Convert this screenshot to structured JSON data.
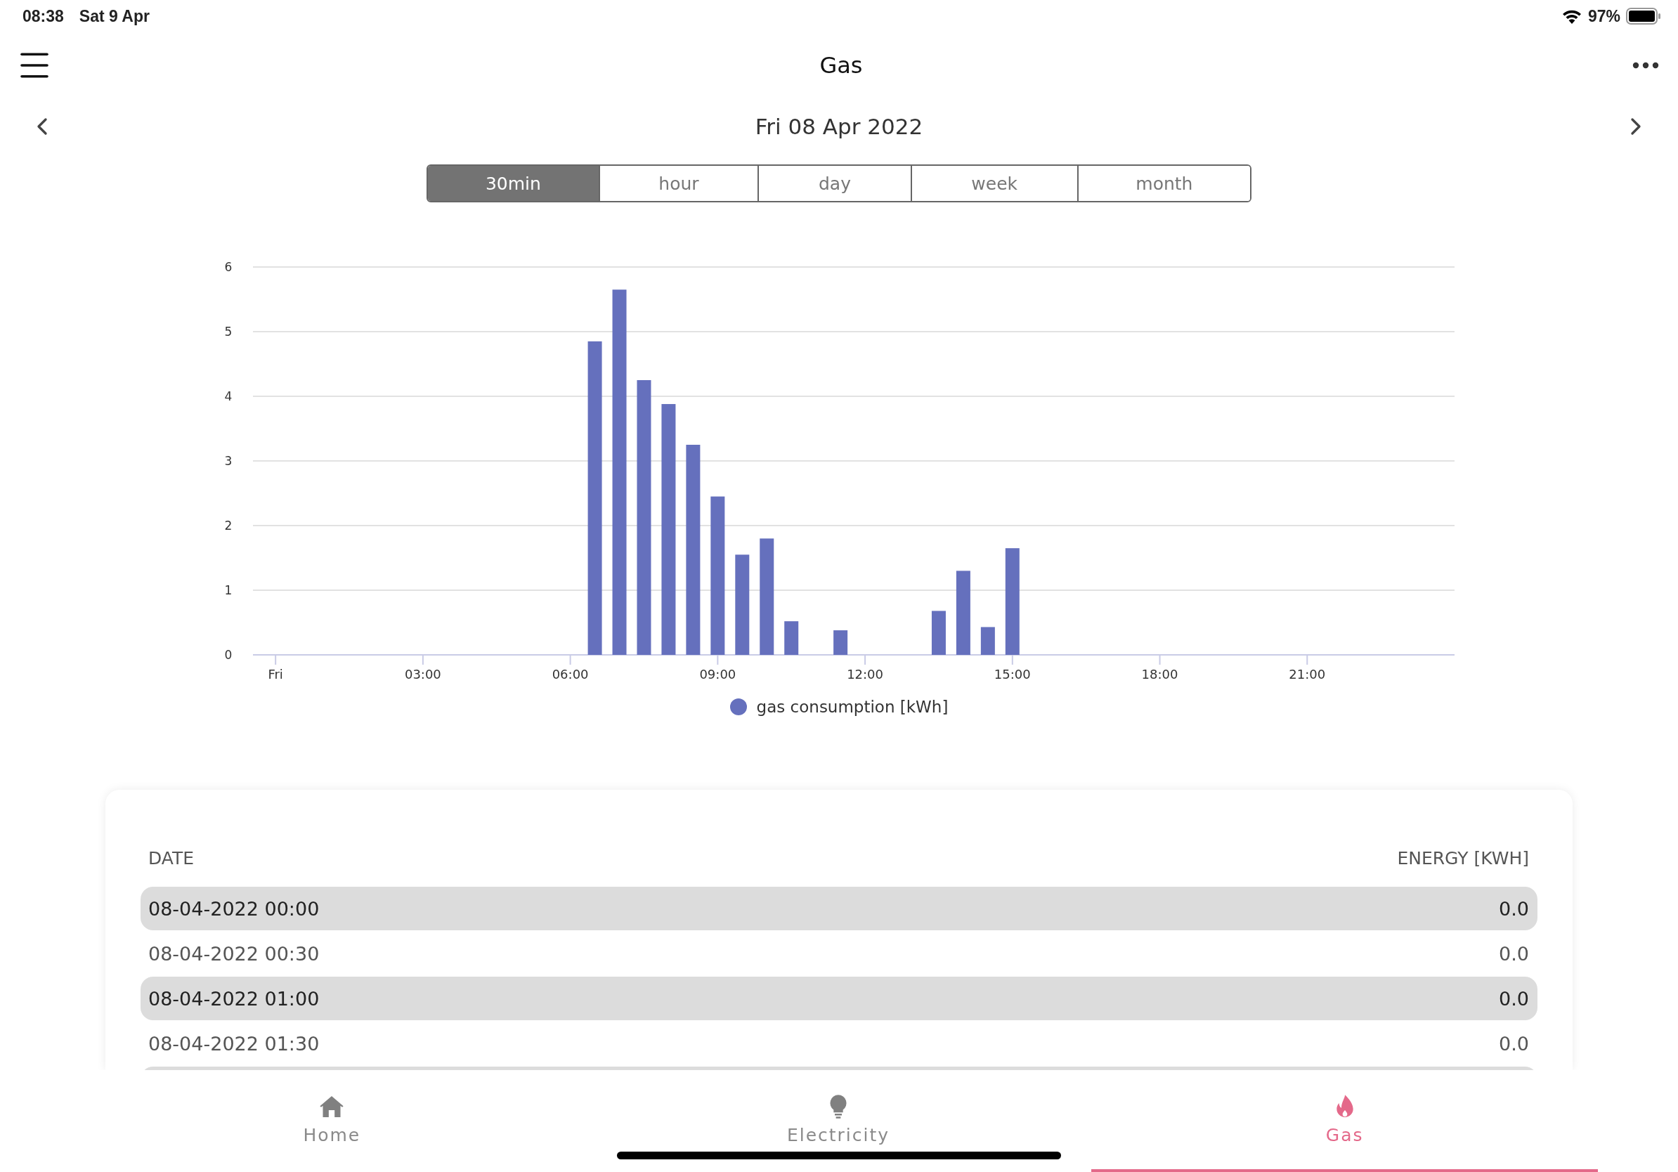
{
  "status_bar": {
    "time": "08:38",
    "date": "Sat 9 Apr",
    "battery": "97%"
  },
  "header": {
    "title": "Gas"
  },
  "date_nav": {
    "label": "Fri 08 Apr 2022"
  },
  "periods": [
    {
      "label": "30min",
      "selected": true
    },
    {
      "label": "hour",
      "selected": false
    },
    {
      "label": "day",
      "selected": false
    },
    {
      "label": "week",
      "selected": false
    },
    {
      "label": "month",
      "selected": false
    }
  ],
  "chart_data": {
    "type": "bar",
    "x": [
      6.5,
      7,
      7.5,
      8,
      8.5,
      9,
      9.5,
      10,
      10.5,
      11.5,
      13.5,
      14,
      14.5,
      15
    ],
    "series": [
      {
        "name": "gas consumption [kWh]",
        "color": "#6570bd",
        "values": [
          4.85,
          5.65,
          4.25,
          3.88,
          3.25,
          2.45,
          1.55,
          1.8,
          0.52,
          0.38,
          0.68,
          1.3,
          0.43,
          1.65
        ]
      }
    ],
    "xlim": [
      -0.46,
      24
    ],
    "ylim": [
      0,
      6
    ],
    "grid": true,
    "xticks": [
      {
        "value": 0,
        "label": "Fri"
      },
      {
        "value": 3,
        "label": "03:00"
      },
      {
        "value": 6,
        "label": "06:00"
      },
      {
        "value": 9,
        "label": "09:00"
      },
      {
        "value": 12,
        "label": "12:00"
      },
      {
        "value": 15,
        "label": "15:00"
      },
      {
        "value": 18,
        "label": "18:00"
      },
      {
        "value": 21,
        "label": "21:00"
      }
    ],
    "yticks": [
      0,
      1,
      2,
      3,
      4,
      5,
      6
    ]
  },
  "table": {
    "columns": [
      "DATE",
      "ENERGY [KWH]"
    ],
    "rows": [
      [
        "08-04-2022 00:00",
        "0.0"
      ],
      [
        "08-04-2022 00:30",
        "0.0"
      ],
      [
        "08-04-2022 01:00",
        "0.0"
      ],
      [
        "08-04-2022 01:30",
        "0.0"
      ]
    ]
  },
  "tab_bar": [
    {
      "kind": "home",
      "label": "Home",
      "selected": false
    },
    {
      "kind": "electricity",
      "label": "Electricity",
      "selected": false
    },
    {
      "kind": "gas",
      "label": "Gas",
      "selected": true
    }
  ]
}
